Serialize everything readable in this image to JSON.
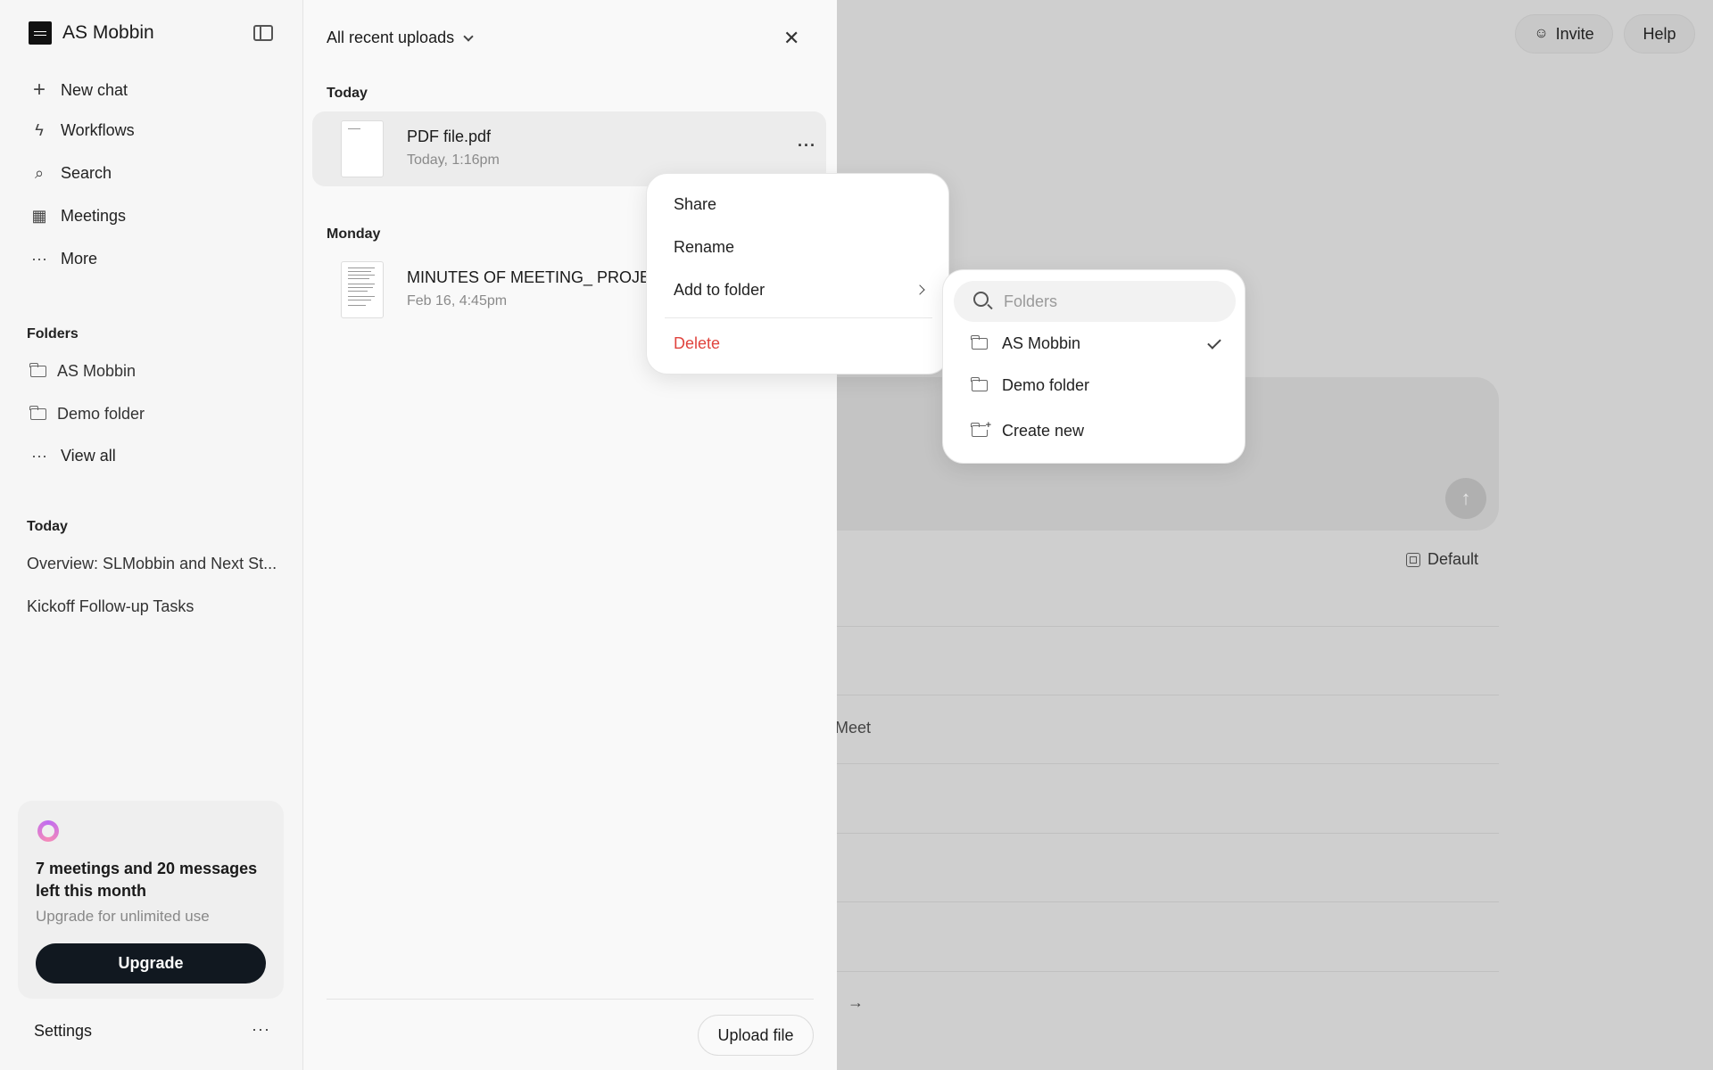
{
  "sidebar": {
    "brand": "AS Mobbin",
    "nav": [
      {
        "label": "New chat",
        "icon": "plus-icon"
      },
      {
        "label": "Workflows",
        "icon": "bolt-icon"
      },
      {
        "label": "Search",
        "icon": "search-icon"
      },
      {
        "label": "Meetings",
        "icon": "calendar-icon"
      },
      {
        "label": "More",
        "icon": "ellipsis-icon"
      }
    ],
    "folders_title": "Folders",
    "folders": [
      "AS Mobbin",
      "Demo folder"
    ],
    "view_all": "View all",
    "recent_title": "Today",
    "recent": [
      "Overview: SLMobbin and Next St...",
      "Kickoff Follow-up Tasks"
    ],
    "upsell": {
      "title": "7 meetings and 20 messages left this month",
      "subtitle": "Upgrade for unlimited use",
      "button": "Upgrade"
    },
    "settings": "Settings"
  },
  "uploads": {
    "filter": "All recent uploads",
    "groups": [
      {
        "day": "Today",
        "files": [
          {
            "name": "PDF file.pdf",
            "date": "Today, 1:16pm"
          }
        ]
      },
      {
        "day": "Monday",
        "files": [
          {
            "name": "MINUTES OF MEETING_ PROJECT",
            "date": "Feb 16, 4:45pm"
          }
        ]
      }
    ],
    "upload_button": "Upload file"
  },
  "context_menu": {
    "items": [
      "Share",
      "Rename",
      "Add to folder"
    ],
    "delete": "Delete"
  },
  "folder_submenu": {
    "search_placeholder": "Folders",
    "folders": [
      {
        "name": "AS Mobbin",
        "selected": true
      },
      {
        "name": "Demo folder",
        "selected": false
      }
    ],
    "create_new": "Create new"
  },
  "header": {
    "invite": "Invite",
    "help": "Help"
  },
  "main": {
    "model": "Default",
    "bg_text": "Meet"
  },
  "colors": {
    "danger": "#e0443e",
    "primary_button": "#111820"
  }
}
